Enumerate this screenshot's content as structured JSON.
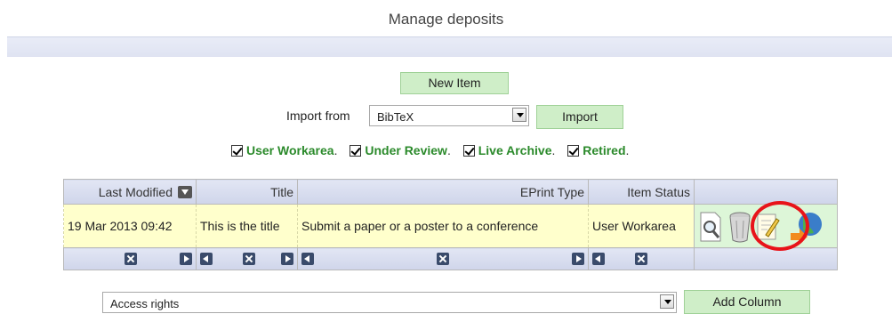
{
  "page": {
    "title": "Manage deposits"
  },
  "toolbar": {
    "new_item_label": "New Item"
  },
  "import": {
    "label": "Import from",
    "selected": "BibTeX",
    "button_label": "Import"
  },
  "filters": [
    {
      "label": "User Workarea",
      "checked": true
    },
    {
      "label": "Under Review",
      "checked": true
    },
    {
      "label": "Live Archive",
      "checked": true
    },
    {
      "label": "Retired",
      "checked": true
    }
  ],
  "table": {
    "columns": [
      "Last Modified",
      "Title",
      "EPrint Type",
      "Item Status"
    ],
    "rows": [
      {
        "last_modified": "19 Mar 2013 09:42",
        "title": "This is the title",
        "eprint_type": "Submit a paper or a poster to a conference",
        "item_status": "User Workarea"
      }
    ],
    "actions": [
      "view-icon",
      "delete-icon",
      "edit-icon",
      "deposit-icon"
    ]
  },
  "add_column": {
    "selected": "Access rights",
    "button_label": "Add Column"
  },
  "colors": {
    "accent_green": "#cfeec8",
    "highlight": "#e8141a",
    "row_bg": "#ffffcc"
  }
}
